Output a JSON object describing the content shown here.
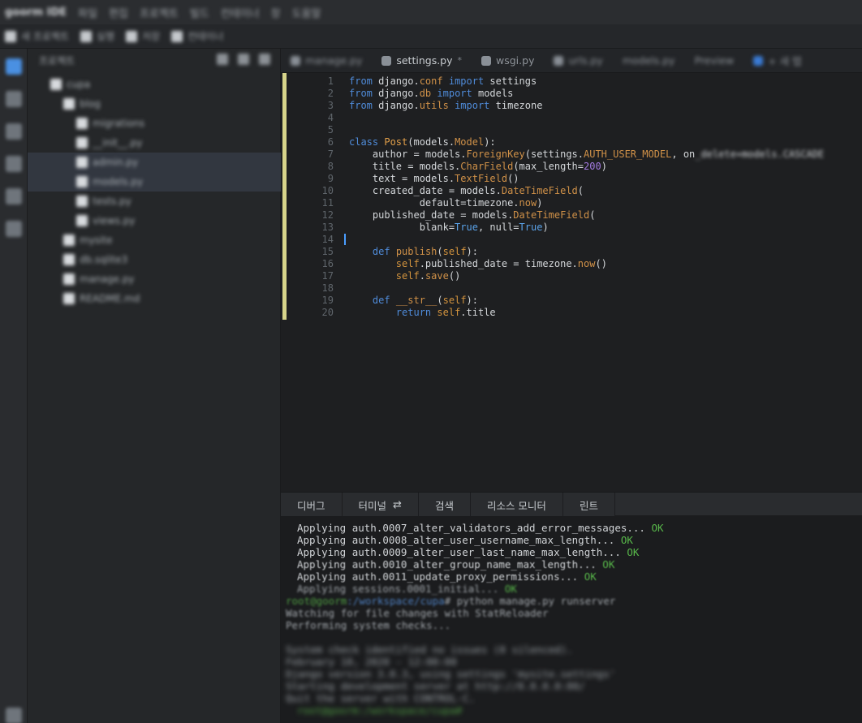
{
  "menubar": {
    "items": [
      "goorm IDE",
      "파일",
      "편집",
      "프로젝트",
      "빌드",
      "컨테이너",
      "창",
      "도움말"
    ]
  },
  "toolbar": {
    "items": [
      "새 프로젝트",
      "실행",
      "저장",
      "컨테이너"
    ]
  },
  "explorer": {
    "title": "프로젝트",
    "rows": [
      {
        "label": "cupa",
        "depth": 0,
        "selected": false
      },
      {
        "label": "blog",
        "depth": 1,
        "selected": false
      },
      {
        "label": "migrations",
        "depth": 2,
        "selected": false
      },
      {
        "label": "__init__.py",
        "depth": 2,
        "selected": false
      },
      {
        "label": "admin.py",
        "depth": 2,
        "selected": true
      },
      {
        "label": "models.py",
        "depth": 2,
        "selected": true
      },
      {
        "label": "tests.py",
        "depth": 2,
        "selected": false
      },
      {
        "label": "views.py",
        "depth": 2,
        "selected": false
      },
      {
        "label": "mysite",
        "depth": 1,
        "selected": false
      },
      {
        "label": "db.sqlite3",
        "depth": 1,
        "selected": false
      },
      {
        "label": "manage.py",
        "depth": 1,
        "selected": false
      },
      {
        "label": "README.md",
        "depth": 1,
        "selected": false
      }
    ]
  },
  "tabs": [
    {
      "label": "manage.py",
      "blur": true
    },
    {
      "label": "settings.py",
      "modified": "*",
      "active": true
    },
    {
      "label": "wsgi.py"
    },
    {
      "label": "urls.py",
      "blur": true
    },
    {
      "label": "models.py",
      "blur": true
    },
    {
      "label": "Preview",
      "blur": true
    },
    {
      "label": "+ 새 탭",
      "blur": true
    }
  ],
  "editor": {
    "line_numbers": [
      "1",
      "2",
      "3",
      "4",
      "5",
      "6",
      "7",
      "8",
      "9",
      "10",
      "11",
      "12",
      "13",
      "14",
      "15",
      "16",
      "17",
      "18",
      "19",
      "20"
    ]
  },
  "panel": {
    "tabs": [
      "디버그",
      "터미널",
      "검색",
      "리소스 모니터",
      "린트"
    ],
    "terminal": [
      {
        "text": "Applying auth.0007_alter_validators_add_error_messages...",
        "ok": " OK"
      },
      {
        "text": "Applying auth.0008_alter_user_username_max_length...",
        "ok": " OK"
      },
      {
        "text": "Applying auth.0009_alter_user_last_name_max_length...",
        "ok": " OK"
      },
      {
        "text": "Applying auth.0010_alter_group_name_max_length...",
        "ok": " OK"
      },
      {
        "text": "Applying auth.0011_update_proxy_permissions...",
        "ok": " OK"
      },
      {
        "text": "Applying sessions.0001_initial...",
        "ok": " OK"
      }
    ],
    "prompt_user": "root@goorm",
    "prompt_path": ":/workspace/cupa",
    "command": "# python manage.py runserver",
    "line_watch": "Watching for file changes with StatReloader",
    "line_checks": "Performing system checks...",
    "blurred_tail": [
      "System check identified no issues (0 silenced).",
      "February 10, 2020 - 12:00:00",
      "Django version 3.0.3, using settings 'mysite.settings'",
      "Starting development server at http://0.0.0.0:80/",
      "Quit the server with CONTROL-C."
    ],
    "final_prompt": "root@goorm:/workspace/cupa#"
  }
}
